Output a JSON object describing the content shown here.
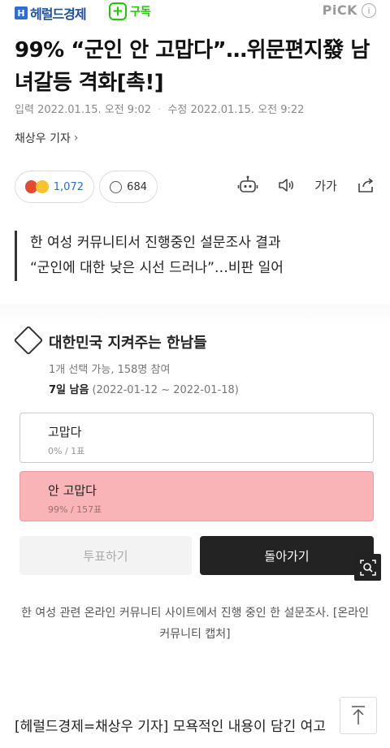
{
  "header": {
    "logo_mark": "H",
    "logo_text": "헤럴드경제",
    "subscribe_plus": "+",
    "subscribe_label": "구독",
    "pick_label": "PiCK",
    "pick_info": "i"
  },
  "article": {
    "title": "99% “군인 안 고맙다”…위문편지發 남녀갈등 격화[촉!]",
    "input_label": "입력",
    "input_date": "2022.01.15. 오전 9:02",
    "modified_label": "수정",
    "modified_date": "2022.01.15. 오전 9:22",
    "reporter": "채상우 기자",
    "reaction_count": "1,072",
    "comment_count": "684",
    "font_size_label": "가가",
    "quote_line1": "한 여성 커뮤니티서 진행중인 설문조사 결과",
    "quote_line2": "“군인에 대한 낮은 시선 드러나”…비판 일어",
    "caption": "한 여성 관련 온라인 커뮤니티 사이트에서 진행 중인 한 설문조사. [온라인 커뮤니티 캡처]",
    "body_start": "[헤럴드경제=채상우 기자] 모욕적인 내용이 담긴 여고"
  },
  "poll": {
    "title": "대한민국 지켜주는 한남들",
    "meta": "1개 선택 가능, 158명 참여",
    "remain": "7일 남음",
    "period": "(2022-01-12 ~ 2022-01-18)",
    "options": [
      {
        "label": "고맙다",
        "stat": "0% / 1표",
        "percent": 0
      },
      {
        "label": "안 고맙다",
        "stat": "99% / 157표",
        "percent": 99
      }
    ],
    "vote_button": "투표하기",
    "back_button": "돌아가기"
  },
  "colors": {
    "brand_blue": "#2b6fd6",
    "subscribe_green": "#1ec800",
    "selected_option": "#f8b4b6"
  }
}
